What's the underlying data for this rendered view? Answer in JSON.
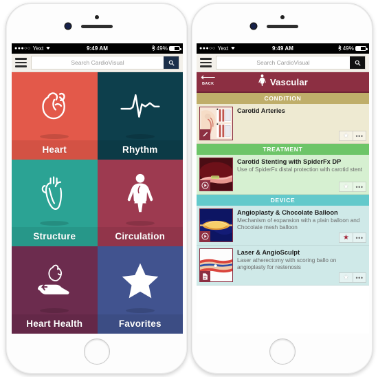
{
  "status_bar": {
    "signal_dots": "●●●○○",
    "carrier": "Yext",
    "wifi_icon": "wifi-icon",
    "time": "9:49 AM",
    "bluetooth_icon": "bluetooth-icon",
    "battery_percent": "49%"
  },
  "search": {
    "placeholder": "Search CardioVisual",
    "value": "",
    "menu_icon": "hamburger-menu-icon",
    "search_icon": "search-icon"
  },
  "home_screen": {
    "tiles": [
      {
        "label": "Heart",
        "icon": "heart-outline-icon",
        "color": "#e3594a"
      },
      {
        "label": "Rhythm",
        "icon": "ecg-waveform-icon",
        "color": "#0d3f4c"
      },
      {
        "label": "Structure",
        "icon": "heart-anatomy-icon",
        "color": "#2ba394"
      },
      {
        "label": "Circulation",
        "icon": "body-circulation-icon",
        "color": "#9d3a50"
      },
      {
        "label": "Heart Health",
        "icon": "heart-in-hand-icon",
        "color": "#6c2c4e"
      },
      {
        "label": "Favorites",
        "icon": "star-icon",
        "color": "#41538f"
      }
    ]
  },
  "category_screen": {
    "back_label": "BACK",
    "back_icon": "back-arrow-icon",
    "title": "Vascular",
    "title_icon": "body-vascular-icon",
    "header_color": "#8c2f42",
    "sections": [
      {
        "name": "CONDITION",
        "header_color": "#bfae6a",
        "row_bg": "#eeead2",
        "items": [
          {
            "title": "Carotid Arteries",
            "subtitle": "",
            "thumb": "carotid-anatomy-illustration",
            "badge_icon": "slide-pencil-icon",
            "favorited": false,
            "more_icon": "more-options-icon"
          }
        ]
      },
      {
        "name": "TREATMENT",
        "header_color": "#6dc568",
        "row_bg": "#d6f0d1",
        "items": [
          {
            "title": "Carotid Stenting with SpiderFx DP",
            "subtitle": "Use of SpiderFx distal protection with carotid stent",
            "thumb": "carotid-stent-video-thumbnail",
            "badge_icon": "play-icon",
            "favorited": false,
            "more_icon": "more-options-icon"
          }
        ]
      },
      {
        "name": "DEVICE",
        "header_color": "#63c9cb",
        "row_bg": "#cfe9e8",
        "items": [
          {
            "title": "Angioplasty & Chocolate Balloon",
            "subtitle": "Mechanism of expansion with a plain balloon and Chocolate mesh balloon",
            "thumb": "balloon-angioplasty-video-thumbnail",
            "badge_icon": "play-icon",
            "favorited": true,
            "more_icon": "more-options-icon"
          },
          {
            "title": "Laser & AngioSculpt",
            "subtitle": "Laser atherectomy with scoring ballo on angioplasty for restenosis",
            "thumb": "laser-angiosculpt-illustration",
            "badge_icon": "document-icon",
            "favorited": false,
            "more_icon": "more-options-icon"
          }
        ]
      }
    ]
  }
}
